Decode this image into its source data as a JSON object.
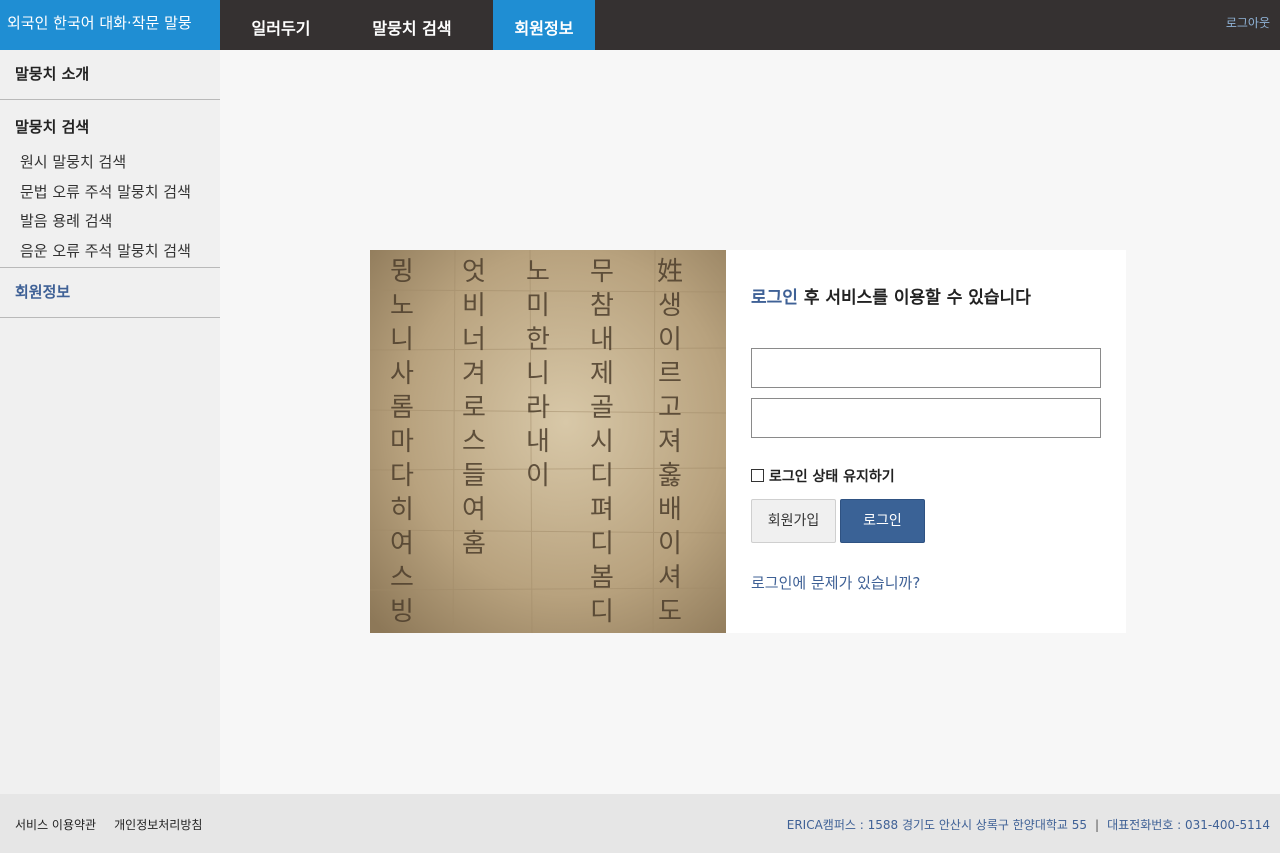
{
  "header": {
    "brand": "외국인 한국어 대화·작문 말뭉",
    "tabs": [
      {
        "label": "일러두기",
        "active": false
      },
      {
        "label": "말뭉치 검색",
        "active": false
      },
      {
        "label": "회원정보",
        "active": true
      }
    ],
    "logout": "로그아웃"
  },
  "sidebar": {
    "intro": "말뭉치 소개",
    "intro_ghost": "치",
    "search_head": "말뭉치 검색",
    "search_items": [
      "원시 말뭉치 검색",
      "문법 오류 주석 말뭉치 검색",
      "발음 용례 검색",
      "음운 오류 주석 말뭉치 검색"
    ],
    "member": "회원정보"
  },
  "login": {
    "title_highlight": "로그인",
    "title_rest": " 후 서비스를 이용할 수 있습니다",
    "id_value": "",
    "pw_value": "",
    "remember": "로그인 상태 유지하기",
    "join_button": "회원가입",
    "login_button": "로그인",
    "trouble_link": "로그인에 문제가 있습니까?",
    "image_glyphs": [
      "뮝",
      "노",
      "니",
      "사",
      "롬",
      "마",
      "다",
      "히",
      "여",
      "스",
      "빙",
      "엇",
      "비",
      "너",
      "겨",
      "로",
      "스",
      "들",
      "여",
      "홈",
      "노",
      "미",
      "한",
      "니",
      "라",
      "내",
      "이",
      "무",
      "참",
      "내",
      "제",
      "골",
      "시",
      "디",
      "펴",
      "디",
      "봄",
      "디",
      "姓",
      "생",
      "이",
      "르",
      "고",
      "져",
      "홇",
      "배",
      "이",
      "셔",
      "도"
    ]
  },
  "footer": {
    "links": [
      "서비스 이용약관",
      "개인정보처리방침"
    ],
    "address": "ERICA캠퍼스 : 1588 경기도 안산시 상록구 한양대학교 55",
    "separator": "|",
    "phone": "대표전화번호 : 031-400-5114"
  },
  "colors": {
    "topbar": "#353131",
    "accent_blue": "#1f8ed3",
    "link_blue": "#3f6196",
    "login_button": "#3a6296"
  }
}
